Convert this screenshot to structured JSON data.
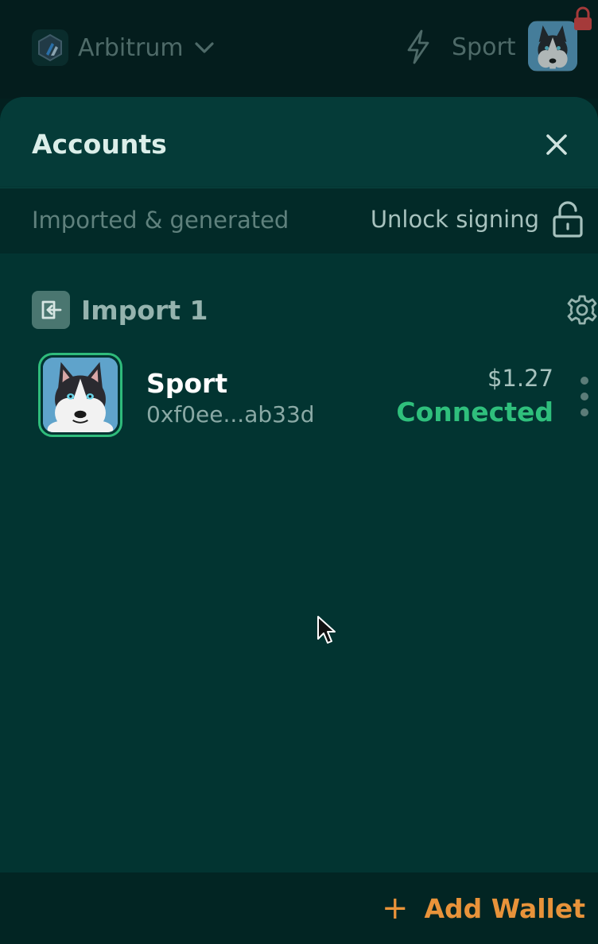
{
  "topbar": {
    "network_name": "Arbitrum",
    "network_icon": "arbitrum-logo",
    "account_name": "Sport"
  },
  "sheet": {
    "title": "Accounts",
    "filter_label": "Imported & generated",
    "unlock_label": "Unlock signing"
  },
  "group": {
    "label": "Import 1"
  },
  "account": {
    "name": "Sport",
    "address": "0xf0ee...ab33d",
    "balance": "$1.27",
    "status": "Connected"
  },
  "footer": {
    "add_icon": "+",
    "add_label": "Add Wallet"
  },
  "colors": {
    "background": "#023431",
    "connected": "#2fbf7c",
    "accent": "#e8933a"
  }
}
